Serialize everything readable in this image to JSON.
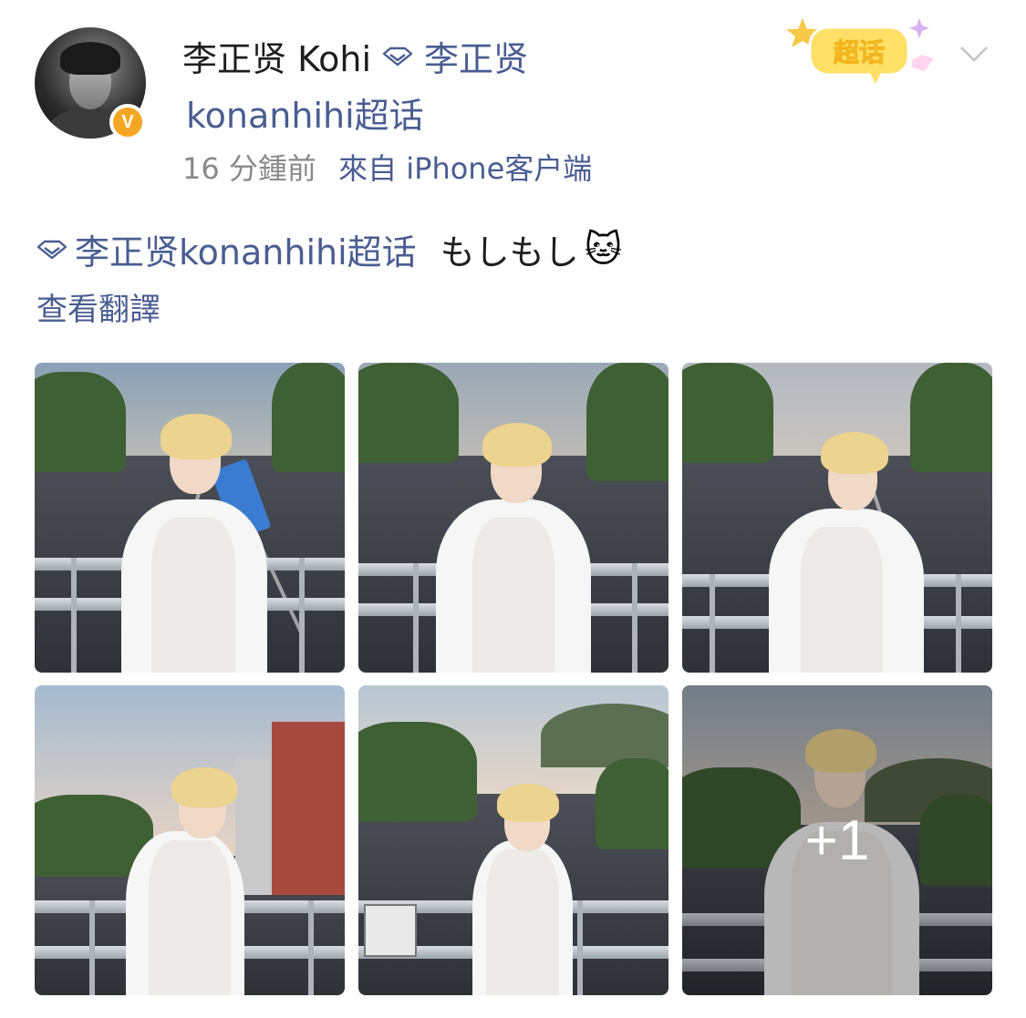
{
  "post": {
    "author_name": "李正贤 Kohi",
    "super_topic_prefix": "李正贤",
    "super_topic_suffix": "konanhihi超话",
    "time_ago": "16 分鍾前",
    "source": "來自 iPhone客户端",
    "badge_label": "超话",
    "verified_mark": "V"
  },
  "body": {
    "tag": "李正贤konanhihi超话",
    "text": "もしもし",
    "emoji": "🐱",
    "translate_label": "查看翻譯"
  },
  "photos": {
    "more_count": "+1",
    "items": [
      {
        "name": "photo-1"
      },
      {
        "name": "photo-2"
      },
      {
        "name": "photo-3"
      },
      {
        "name": "photo-4"
      },
      {
        "name": "photo-5"
      },
      {
        "name": "photo-6"
      }
    ]
  },
  "colors": {
    "link": "#4a5d92",
    "text": "#1e1e1e",
    "meta": "#8a8a8a",
    "verified": "#f5a623",
    "badge": "#ffd94a"
  }
}
